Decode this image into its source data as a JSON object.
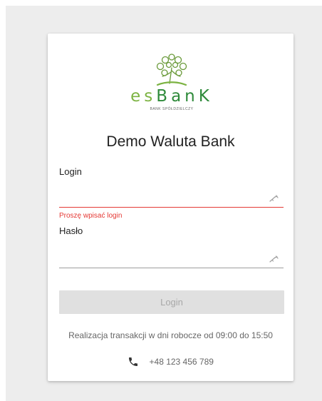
{
  "colors": {
    "background": "#ededed",
    "card": "#ffffff",
    "brand_green": "#2e8a3a",
    "brand_light_green": "#7cb342",
    "error": "#e53935",
    "button_disabled": "#e0e0e0",
    "button_disabled_text": "#a8a8a8",
    "muted_text": "#666666"
  },
  "logo": {
    "word_prefix": "es",
    "word_suffix": "BanK",
    "subtitle": "BANK SPÓŁDZIELCZY",
    "icon": "tree-icon"
  },
  "title": "Demo Waluta Bank",
  "form": {
    "login": {
      "label": "Login",
      "value": "",
      "placeholder": "",
      "icon": "key-icon",
      "error": "Proszę wpisać login"
    },
    "password": {
      "label": "Hasło",
      "value": "",
      "placeholder": "",
      "icon": "key-icon"
    },
    "submit_label": "Login"
  },
  "footer": {
    "hours": "Realizacja transakcji w dni robocze od 09:00 do 15:50",
    "phone": "+48 123 456 789",
    "phone_icon": "phone-icon"
  }
}
